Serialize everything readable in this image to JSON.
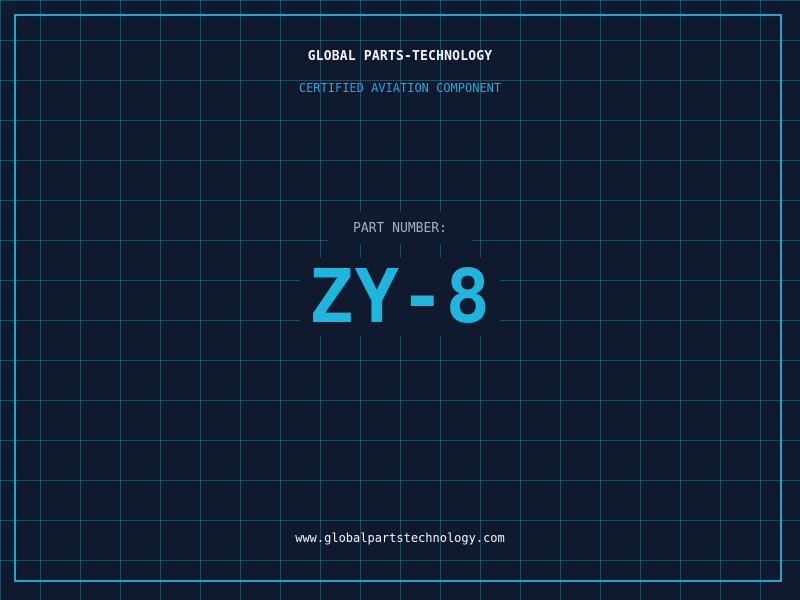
{
  "header": {
    "company_name": "GLOBAL PARTS-TECHNOLOGY",
    "tagline": "CERTIFIED AVIATION COMPONENT"
  },
  "part": {
    "label": "PART NUMBER:",
    "number": "ZY-8"
  },
  "footer": {
    "url": "www.globalpartstechnology.com"
  },
  "colors": {
    "background": "#0f1a2f",
    "grid": "#2c8caa",
    "accent": "#1eb6dc",
    "text": "#f2f5f8",
    "muted": "#a7b0bc"
  }
}
